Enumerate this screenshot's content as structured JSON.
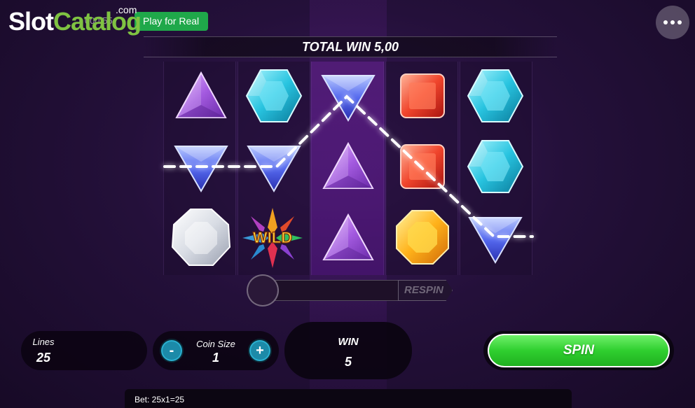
{
  "brand": {
    "slot": "Slot",
    "catalog": "Catalog",
    "com": ".com"
  },
  "header": {
    "balance": "1 000.55",
    "play_for_real": "Play for Real",
    "menu_icon": "more-dots-icon"
  },
  "banner": {
    "total_win": "TOTAL WIN 5,00"
  },
  "reels": {
    "columns": [
      [
        "purple-triangle-gem",
        "blue-inverted-triangle-gem",
        "white-diamond-gem"
      ],
      [
        "cyan-hexagon-gem",
        "blue-inverted-triangle-gem",
        "wild"
      ],
      [
        "blue-inverted-triangle-gem",
        "purple-triangle-gem",
        "purple-triangle-gem"
      ],
      [
        "red-square-gem",
        "red-square-gem",
        "orange-octagon-gem"
      ],
      [
        "cyan-hexagon-gem",
        "cyan-hexagon-gem",
        "blue-inverted-triangle-gem"
      ]
    ],
    "wild_label": "WILD"
  },
  "respin": {
    "label": "RESPIN"
  },
  "controls": {
    "lines_label": "Lines",
    "lines_value": "25",
    "coin_size_label": "Coin Size",
    "coin_size_value": "1",
    "minus_label": "-",
    "plus_label": "+",
    "win_label": "WIN",
    "win_value": "5",
    "spin_label": "SPIN"
  },
  "footer": {
    "bet": "Bet: 25x1=25"
  },
  "colors": {
    "spin_green": "#2fcf2f",
    "play_real_green": "#1fa84a",
    "coin_button_blue": "#1c8aa8",
    "brand_green": "#7fc242"
  }
}
